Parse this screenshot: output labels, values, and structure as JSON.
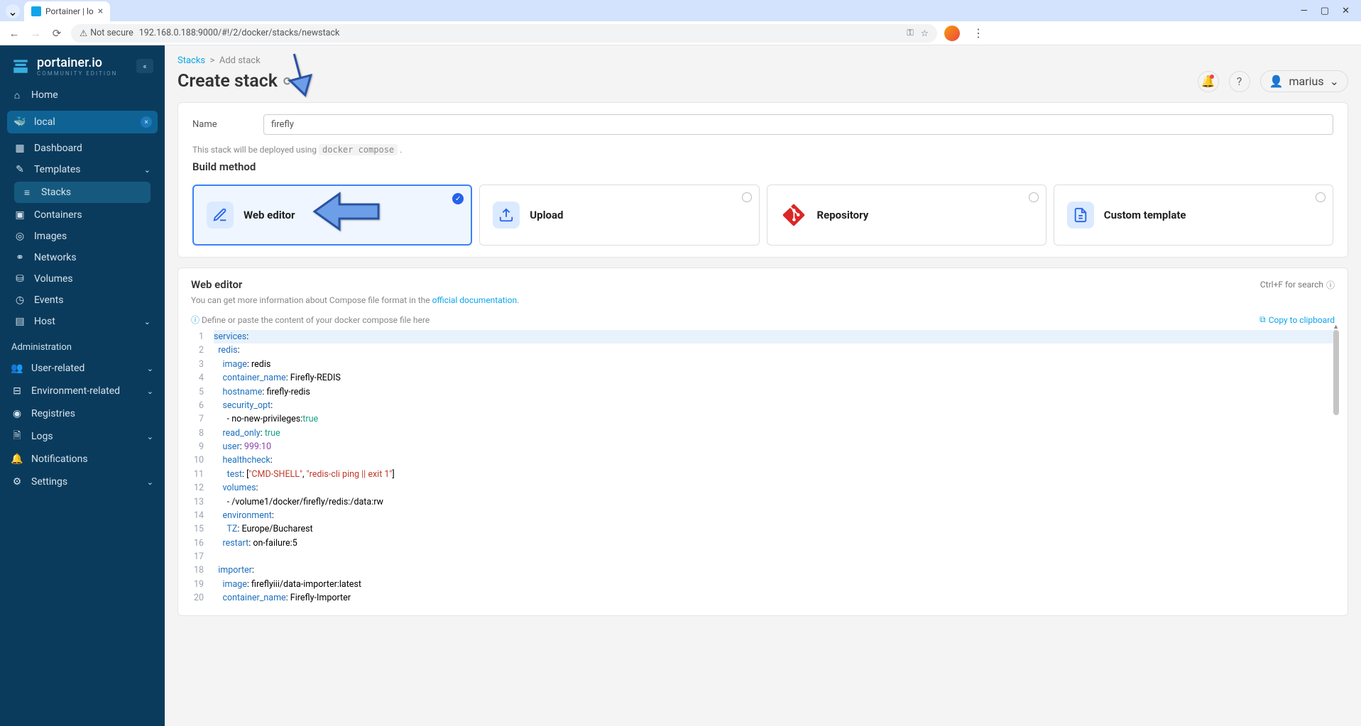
{
  "browser": {
    "tab_title": "Portainer | lo",
    "url": "192.168.0.188:9000/#!/2/docker/stacks/newstack",
    "security": "Not secure"
  },
  "sidebar": {
    "brand": "portainer.io",
    "edition": "COMMUNITY EDITION",
    "home": "Home",
    "env": "local",
    "items": [
      "Dashboard",
      "Templates",
      "Stacks",
      "Containers",
      "Images",
      "Networks",
      "Volumes",
      "Events",
      "Host"
    ],
    "admin_header": "Administration",
    "admin_items": [
      "User-related",
      "Environment-related",
      "Registries",
      "Logs",
      "Notifications",
      "Settings"
    ]
  },
  "breadcrumb": {
    "root": "Stacks",
    "leaf": "Add stack"
  },
  "page": {
    "title": "Create stack",
    "user": "marius"
  },
  "form": {
    "name_label": "Name",
    "name_value": "firefly",
    "deploy_hint_pre": "This stack will be deployed using ",
    "deploy_hint_code": "docker compose",
    "build_title": "Build method",
    "opts": [
      {
        "label": "Web editor"
      },
      {
        "label": "Upload"
      },
      {
        "label": "Repository"
      },
      {
        "label": "Custom template"
      }
    ]
  },
  "editor": {
    "title": "Web editor",
    "search_hint": "Ctrl+F for search",
    "doc_hint_pre": "You can get more information about Compose file format in the ",
    "doc_link": "official documentation",
    "compose_hint": "Define or paste the content of your docker compose file here",
    "copy": "Copy to clipboard",
    "code_lines": [
      "services:",
      "  redis:",
      "    image: redis",
      "    container_name: Firefly-REDIS",
      "    hostname: firefly-redis",
      "    security_opt:",
      "      - no-new-privileges:true",
      "    read_only: true",
      "    user: 999:10",
      "    healthcheck:",
      "      test: [\"CMD-SHELL\", \"redis-cli ping || exit 1\"]",
      "    volumes:",
      "      - /volume1/docker/firefly/redis:/data:rw",
      "    environment:",
      "      TZ: Europe/Bucharest",
      "    restart: on-failure:5",
      "",
      "  importer:",
      "    image: fireflyiii/data-importer:latest",
      "    container_name: Firefly-Importer"
    ]
  }
}
